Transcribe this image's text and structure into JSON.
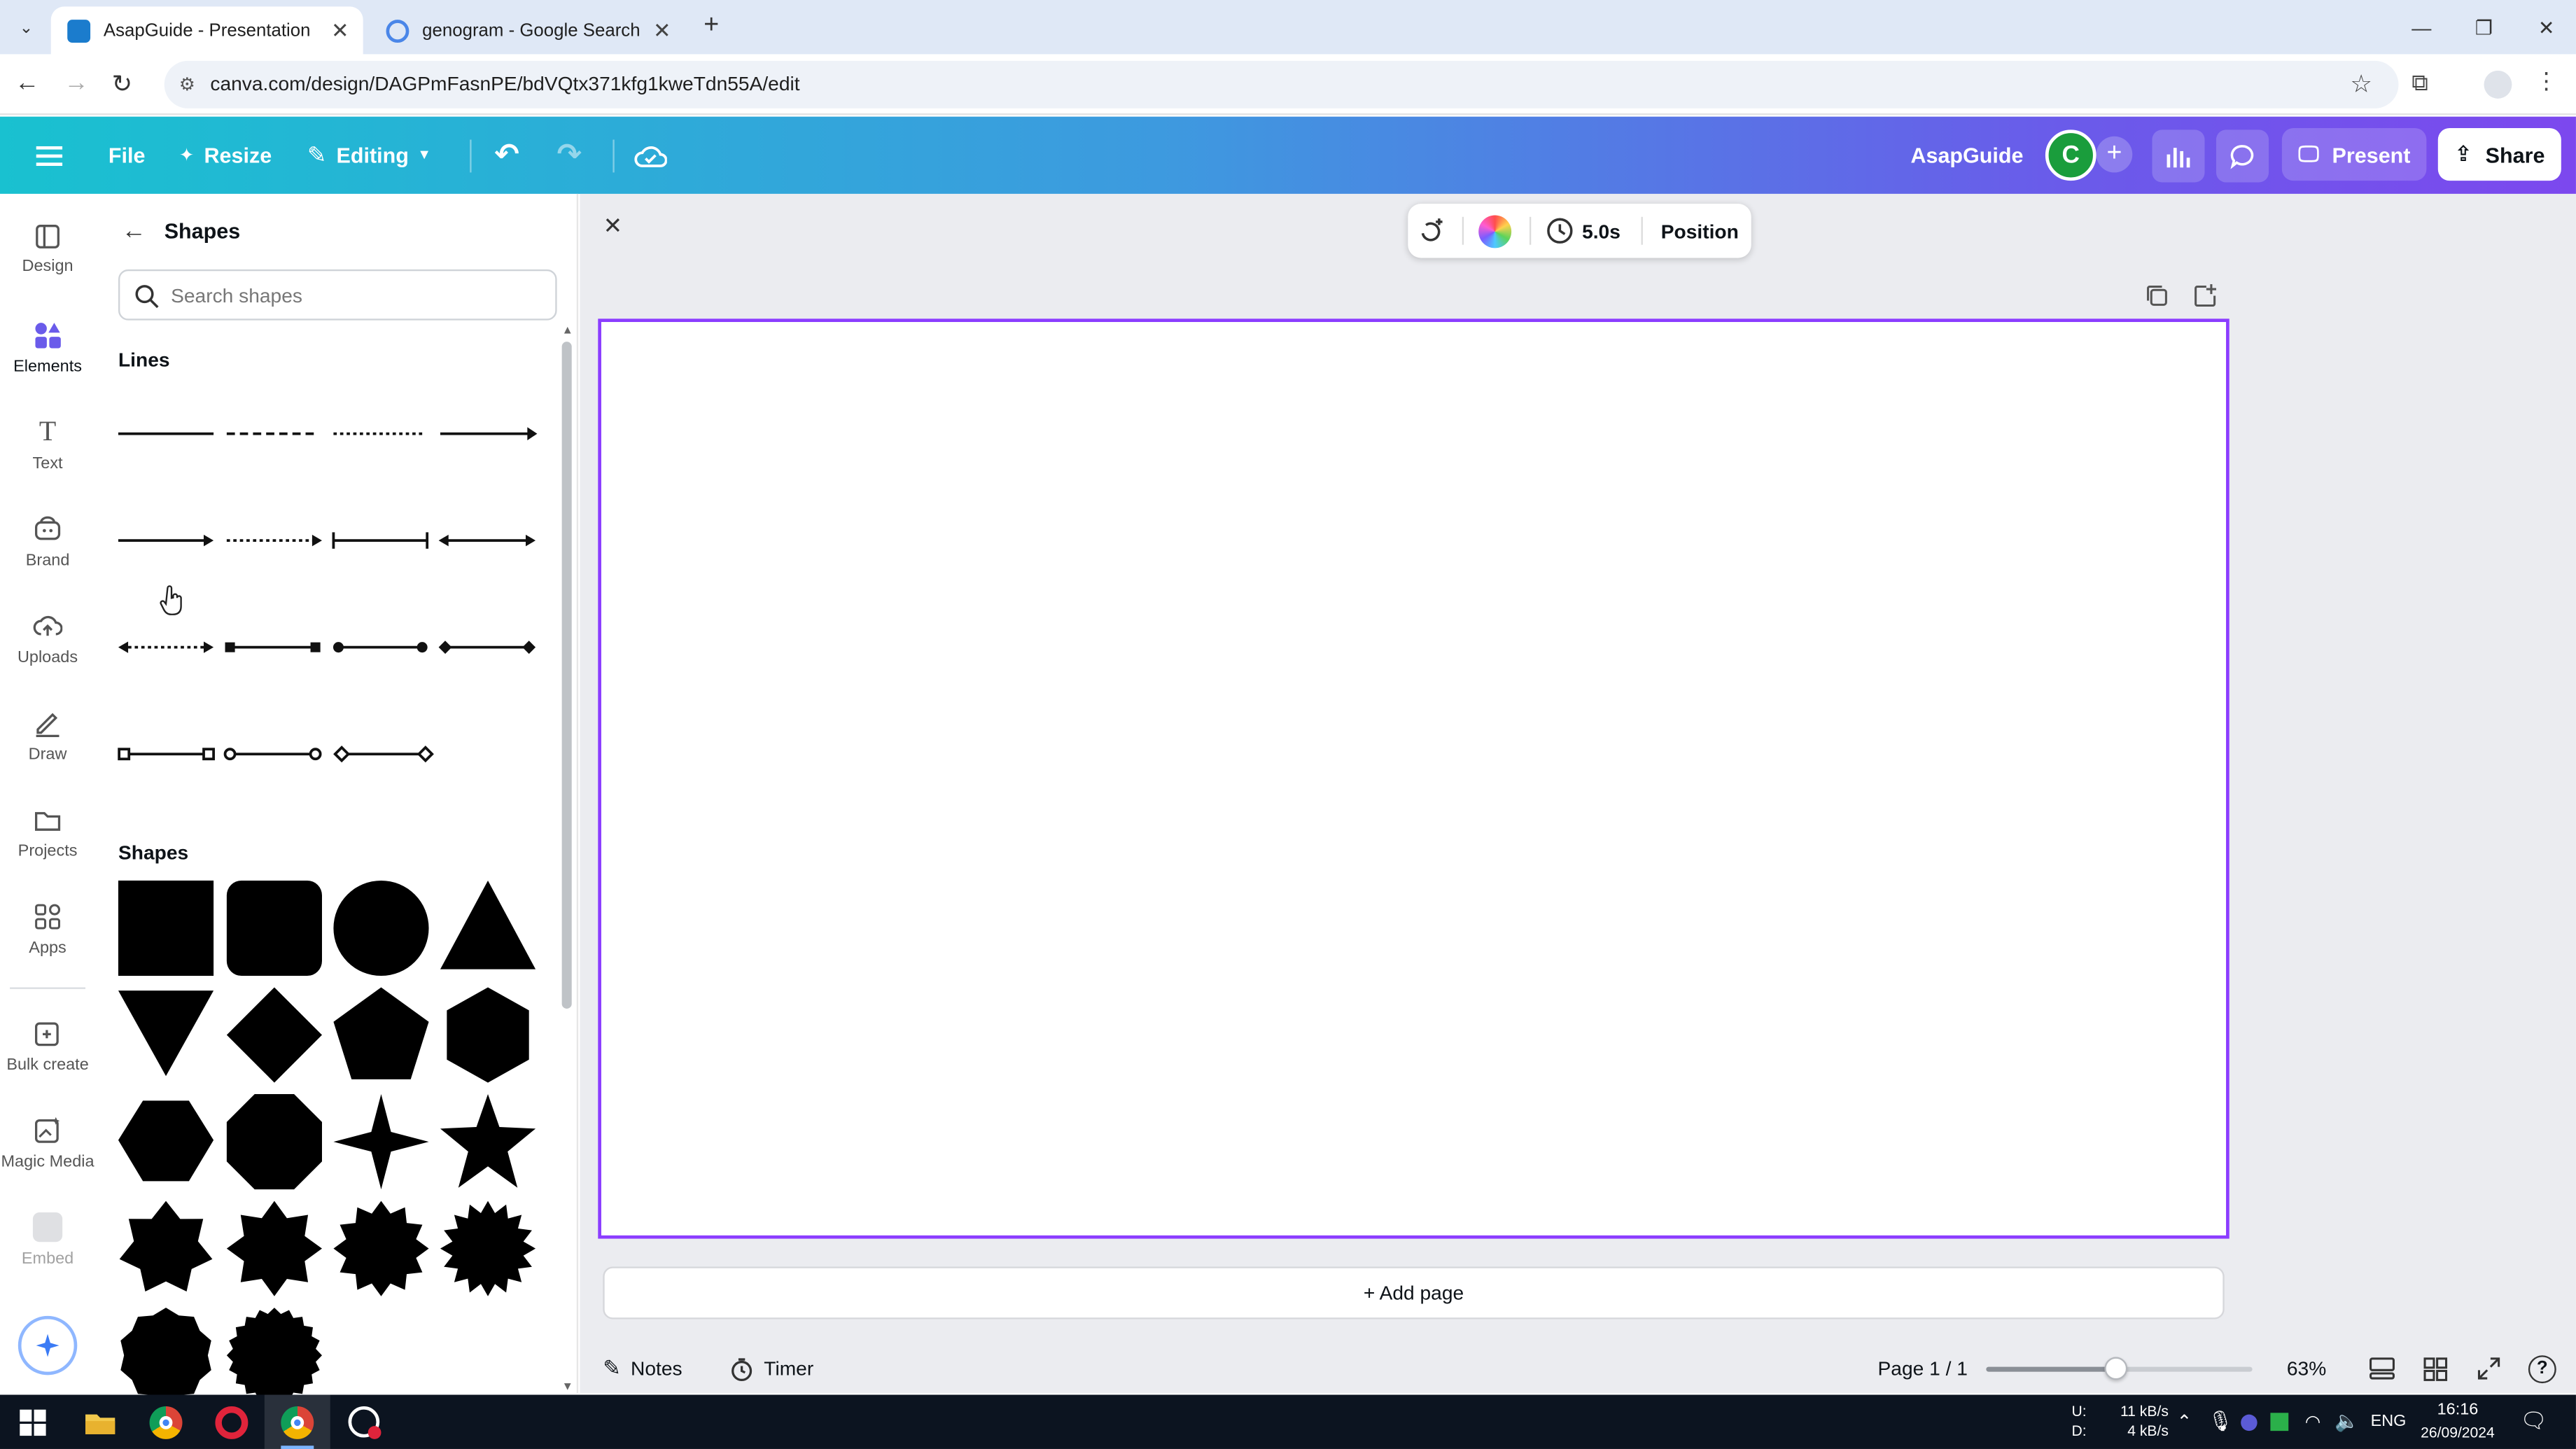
{
  "browser": {
    "tabs": [
      {
        "title": "AsapGuide - Presentation",
        "active": true
      },
      {
        "title": "genogram - Google Search",
        "active": false
      }
    ],
    "url": "canva.com/design/DAGPmFasnPE/bdVQtx371kfg1kweTdn55A/edit"
  },
  "header": {
    "file": "File",
    "resize": "Resize",
    "editing": "Editing",
    "project_name": "AsapGuide",
    "avatar_letter": "C",
    "present": "Present",
    "share": "Share"
  },
  "rail": [
    {
      "label": "Design",
      "icon": "design-icon"
    },
    {
      "label": "Elements",
      "icon": "elements-icon",
      "active": true
    },
    {
      "label": "Text",
      "icon": "text-icon"
    },
    {
      "label": "Brand",
      "icon": "brand-icon"
    },
    {
      "label": "Uploads",
      "icon": "uploads-icon"
    },
    {
      "label": "Draw",
      "icon": "draw-icon"
    },
    {
      "label": "Projects",
      "icon": "projects-icon"
    },
    {
      "label": "Apps",
      "icon": "apps-icon"
    },
    {
      "label": "Bulk create",
      "icon": "bulk-create-icon"
    },
    {
      "label": "Magic Media",
      "icon": "magic-media-icon"
    },
    {
      "label": "Embed",
      "icon": "embed-icon"
    }
  ],
  "panel": {
    "title": "Shapes",
    "search_placeholder": "Search shapes",
    "lines_heading": "Lines",
    "shapes_heading": "Shapes"
  },
  "context_toolbar": {
    "duration": "5.0s",
    "position": "Position"
  },
  "canvas": {
    "add_page": "+ Add page"
  },
  "footer": {
    "notes": "Notes",
    "timer": "Timer",
    "page_indicator": "Page 1 / 1",
    "zoom": "63%",
    "zoom_level": 0.49
  },
  "taskbar": {
    "net_up_label": "U:",
    "net_down_label": "D:",
    "net_up": "11 kB/s",
    "net_down": "4 kB/s",
    "lang": "ENG",
    "time": "16:16",
    "date": "26/09/2024"
  },
  "colors": {
    "accent_purple": "#8b3dff",
    "header_start": "#19c1d0",
    "header_end": "#7c48ee",
    "avatar_green": "#1a9d3c"
  }
}
